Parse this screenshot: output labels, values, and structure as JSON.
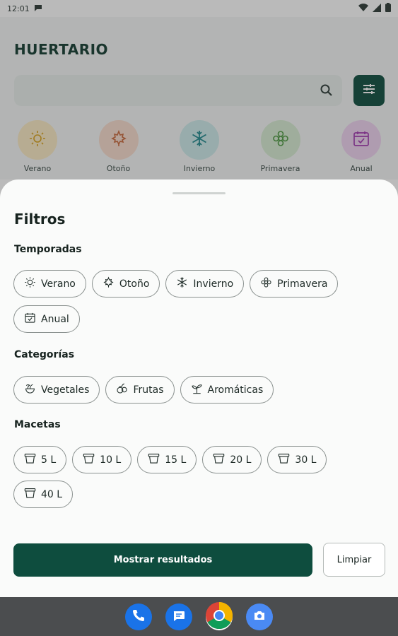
{
  "status_bar": {
    "time": "12:01"
  },
  "app": {
    "title": "HUERTARIO",
    "seasons": [
      {
        "label": "Verano",
        "icon": "sun-icon",
        "bg": "#fbeac4",
        "color": "#d9a21c"
      },
      {
        "label": "Otoño",
        "icon": "maple-leaf-icon",
        "bg": "#f8dccd",
        "color": "#c9673a"
      },
      {
        "label": "Invierno",
        "icon": "snowflake-icon",
        "bg": "#cdeaea",
        "color": "#1f8a8e"
      },
      {
        "label": "Primavera",
        "icon": "flower-icon",
        "bg": "#d8ecd3",
        "color": "#4d9a42"
      },
      {
        "label": "Anual",
        "icon": "calendar-check-icon",
        "bg": "#efd3f1",
        "color": "#a23ab1"
      }
    ]
  },
  "sheet": {
    "title": "Filtros",
    "seasons_title": "Temporadas",
    "season_chips": [
      {
        "label": "Verano",
        "icon": "sun-icon"
      },
      {
        "label": "Otoño",
        "icon": "maple-leaf-icon"
      },
      {
        "label": "Invierno",
        "icon": "snowflake-icon"
      },
      {
        "label": "Primavera",
        "icon": "flower-icon"
      },
      {
        "label": "Anual",
        "icon": "calendar-check-icon"
      }
    ],
    "categories_title": "Categorías",
    "category_chips": [
      {
        "label": "Vegetales",
        "icon": "vegetables-icon"
      },
      {
        "label": "Frutas",
        "icon": "fruits-icon"
      },
      {
        "label": "Aromáticas",
        "icon": "sprout-icon"
      }
    ],
    "pots_title": "Macetas",
    "pot_chips": [
      {
        "label": "5 L",
        "icon": "pot-icon"
      },
      {
        "label": "10 L",
        "icon": "pot-icon"
      },
      {
        "label": "15 L",
        "icon": "pot-icon"
      },
      {
        "label": "20 L",
        "icon": "pot-icon"
      },
      {
        "label": "30 L",
        "icon": "pot-icon"
      },
      {
        "label": "40 L",
        "icon": "pot-icon"
      }
    ],
    "primary_button": "Mostrar resultados",
    "secondary_button": "Limpiar"
  },
  "colors": {
    "brand": "#0e4d3e",
    "scrim": "rgba(40,40,40,0.32)"
  },
  "dock": [
    {
      "icon": "phone-icon",
      "color": "#1a73e8"
    },
    {
      "icon": "messages-icon",
      "color": "#1a73e8"
    },
    {
      "icon": "chrome-icon",
      "color": "#ffffff"
    },
    {
      "icon": "camera-icon",
      "color": "#4a8af4"
    }
  ]
}
